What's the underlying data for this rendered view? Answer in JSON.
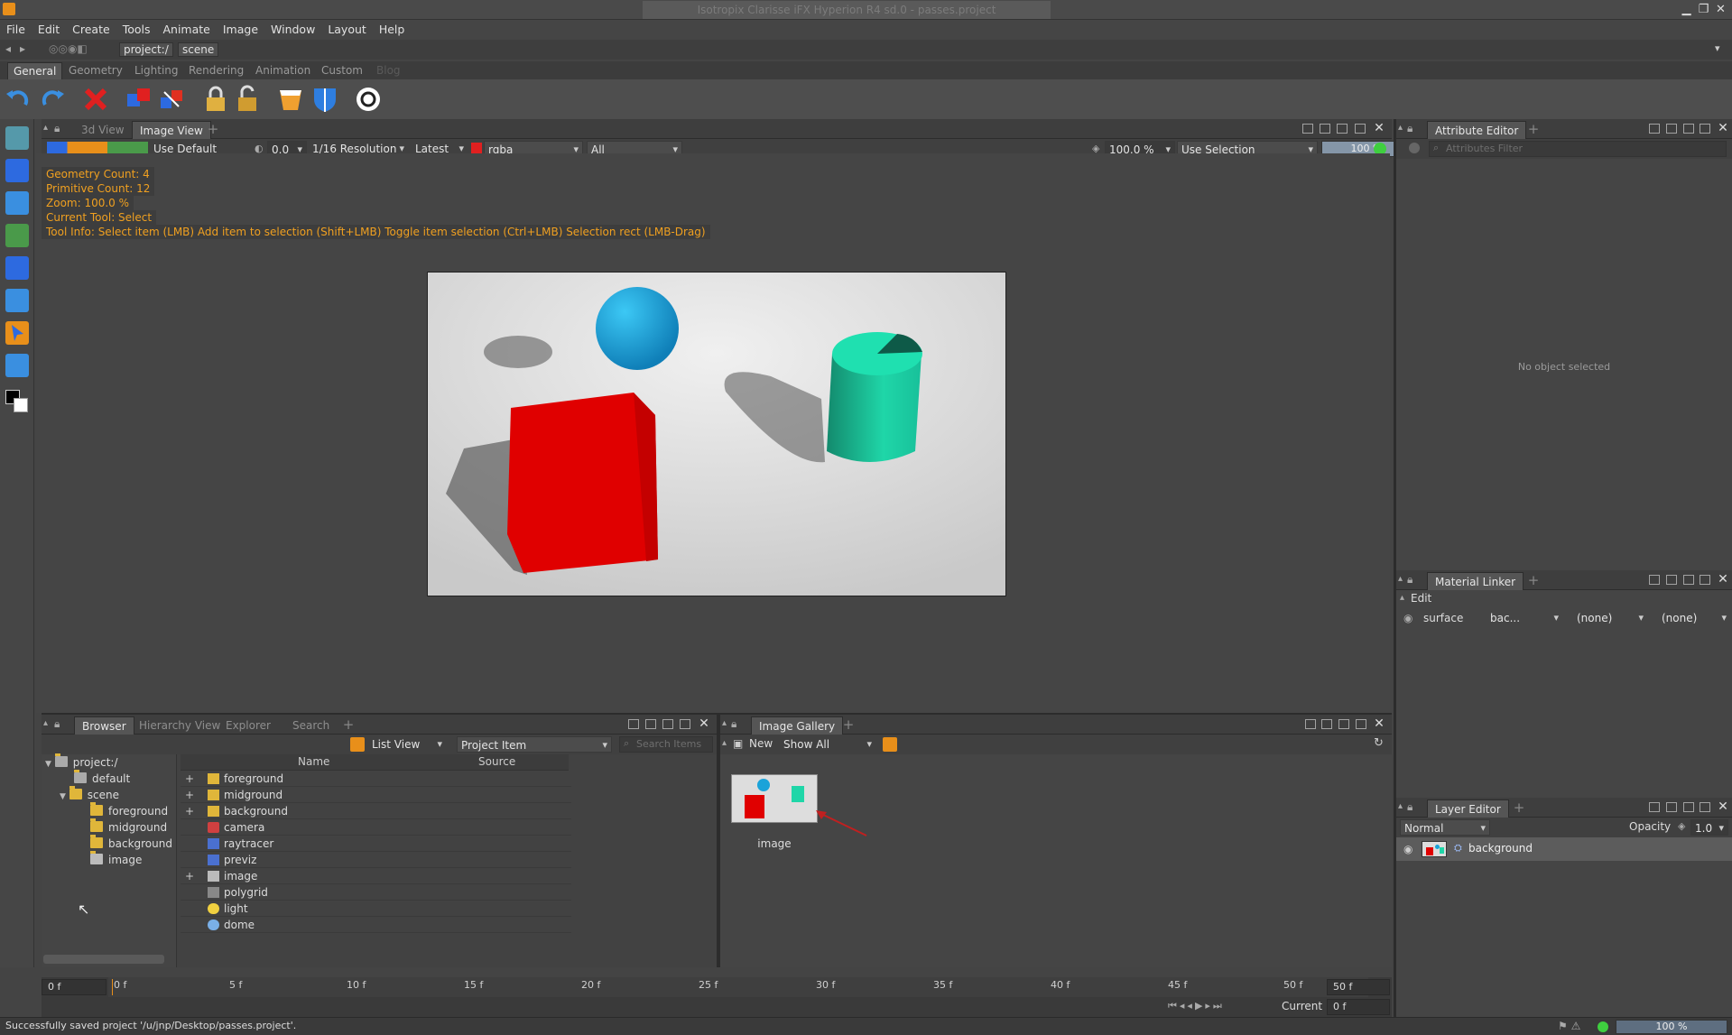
{
  "window": {
    "title": "Isotropix Clarisse iFX Hyperion R4 sd.0 - passes.project"
  },
  "menu": [
    "File",
    "Edit",
    "Create",
    "Tools",
    "Animate",
    "Image",
    "Window",
    "Layout",
    "Help"
  ],
  "path": {
    "project": "project:/",
    "scene": "scene"
  },
  "shelf_tabs": [
    "General",
    "Geometry",
    "Lighting",
    "Rendering",
    "Animation",
    "Custom",
    "Blog"
  ],
  "viewer": {
    "tabs": [
      "3d View",
      "Image View"
    ],
    "display_mode": "Use Default",
    "exposure": "0.0",
    "resolution": "1/16 Resolution",
    "version": "Latest",
    "channel": "rgba",
    "layer": "All",
    "zoom": "100.0 %",
    "selection_mode": "Use Selection",
    "progress": "100 %",
    "progress_fraction": 1.0,
    "info": [
      "Geometry Count: 4",
      "Primitive Count: 12",
      "Zoom: 100.0 %",
      "Current Tool: Select",
      "Tool Info: Select item (LMB)  Add item to selection (Shift+LMB)  Toggle item selection (Ctrl+LMB)  Selection rect (LMB-Drag)"
    ]
  },
  "attribute_editor": {
    "title": "Attribute Editor",
    "filter_placeholder": "Attributes Filter",
    "empty": "No object selected"
  },
  "material_linker": {
    "title": "Material Linker",
    "edit_label": "Edit",
    "row": {
      "name": "surface",
      "material": "bac...",
      "disp": "(none)",
      "clip": "(none)"
    }
  },
  "layer_editor": {
    "title": "Layer Editor",
    "blend": "Normal",
    "opacity_label": "Opacity",
    "opacity": "1.0",
    "layer": "background"
  },
  "browser": {
    "tabs": [
      "Browser",
      "Hierarchy View",
      "Explorer",
      "Search"
    ],
    "view_mode": "List View",
    "filter": "Project Item",
    "search_placeholder": "Search Items",
    "tree": [
      {
        "label": "project:/",
        "depth": 0
      },
      {
        "label": "default",
        "depth": 1
      },
      {
        "label": "scene",
        "depth": 1
      },
      {
        "label": "foreground",
        "depth": 2
      },
      {
        "label": "midground",
        "depth": 2
      },
      {
        "label": "background",
        "depth": 2
      },
      {
        "label": "image",
        "depth": 2
      }
    ],
    "columns": [
      "Name",
      "Source"
    ],
    "items": [
      "foreground",
      "midground",
      "background",
      "camera",
      "raytracer",
      "previz",
      "image",
      "polygrid",
      "light",
      "dome"
    ]
  },
  "gallery": {
    "title": "Image Gallery",
    "new_label": "New",
    "filter": "Show All",
    "thumb_label": "image"
  },
  "timeline": {
    "start": "0 f",
    "end": "50 f",
    "ticks": [
      "0 f",
      "5 f",
      "10 f",
      "15 f",
      "20 f",
      "25 f",
      "30 f",
      "35 f",
      "40 f",
      "45 f",
      "50 f"
    ],
    "current_label": "Current",
    "current": "0 f"
  },
  "status": {
    "message": "Successfully saved project '/u/jnp/Desktop/passes.project'.",
    "progress": "100 %"
  },
  "colors": {
    "accent": "#e88f1a",
    "info_text": "#f0a020",
    "cube": "#e00000",
    "sphere": "#1aa3d9",
    "cylinder": "#1fd6a8"
  }
}
